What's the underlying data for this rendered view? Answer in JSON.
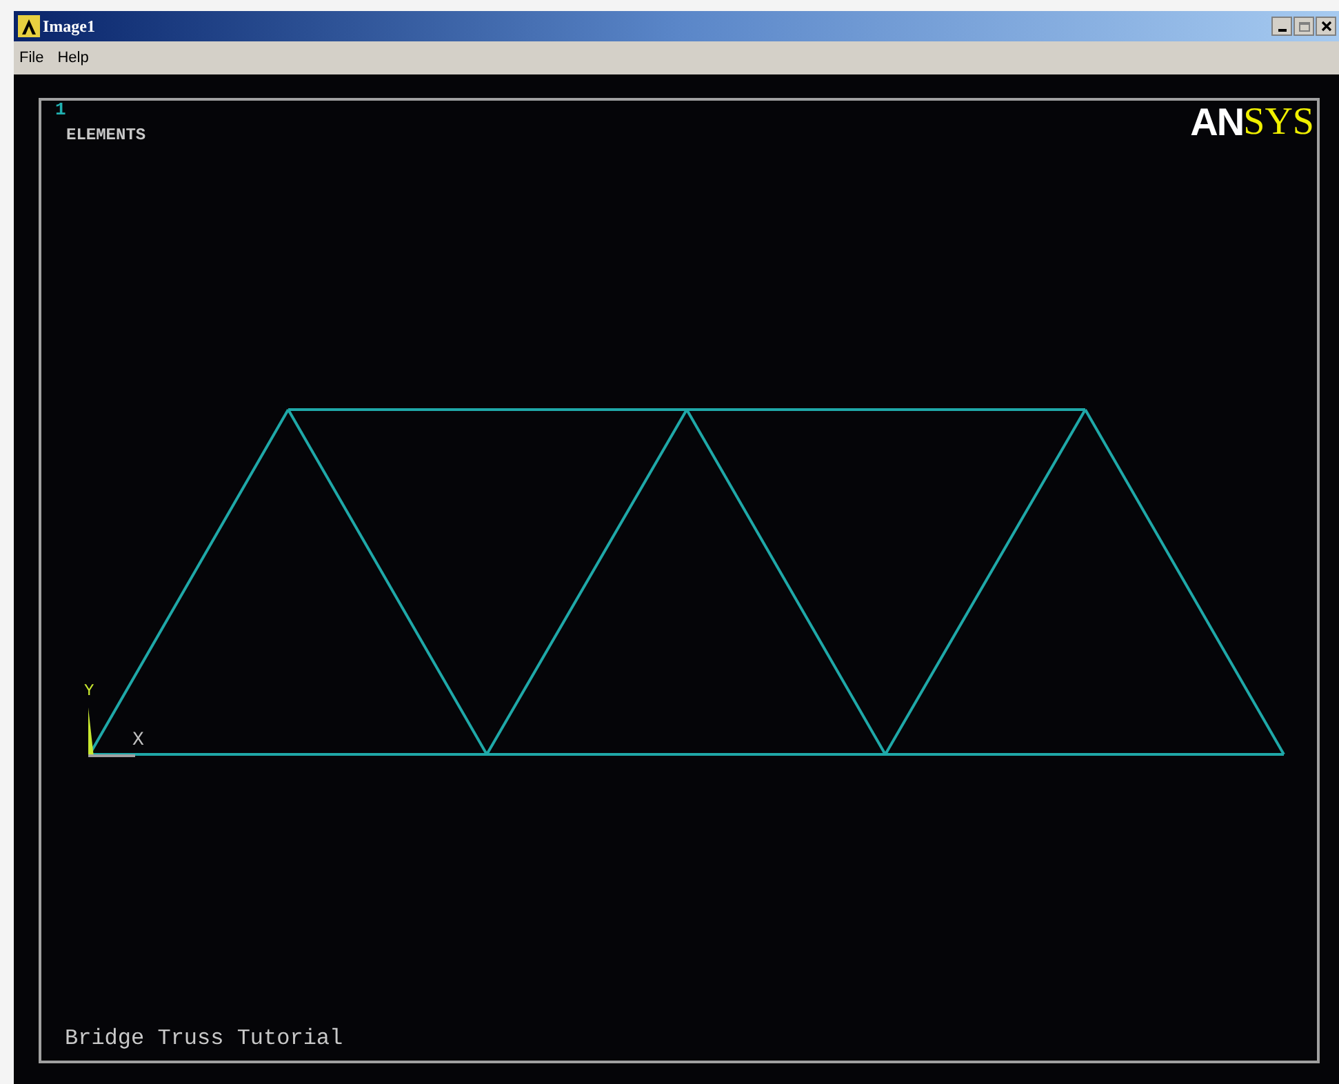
{
  "window": {
    "title": "Image1"
  },
  "menu": [
    "File",
    "Help"
  ],
  "viewport": {
    "window_number": "1",
    "label": "ELEMENTS",
    "logo_first": "AN",
    "logo_second": "SYS",
    "axis_y": "Y",
    "axis_x": "X",
    "caption": "Bridge Truss Tutorial"
  }
}
